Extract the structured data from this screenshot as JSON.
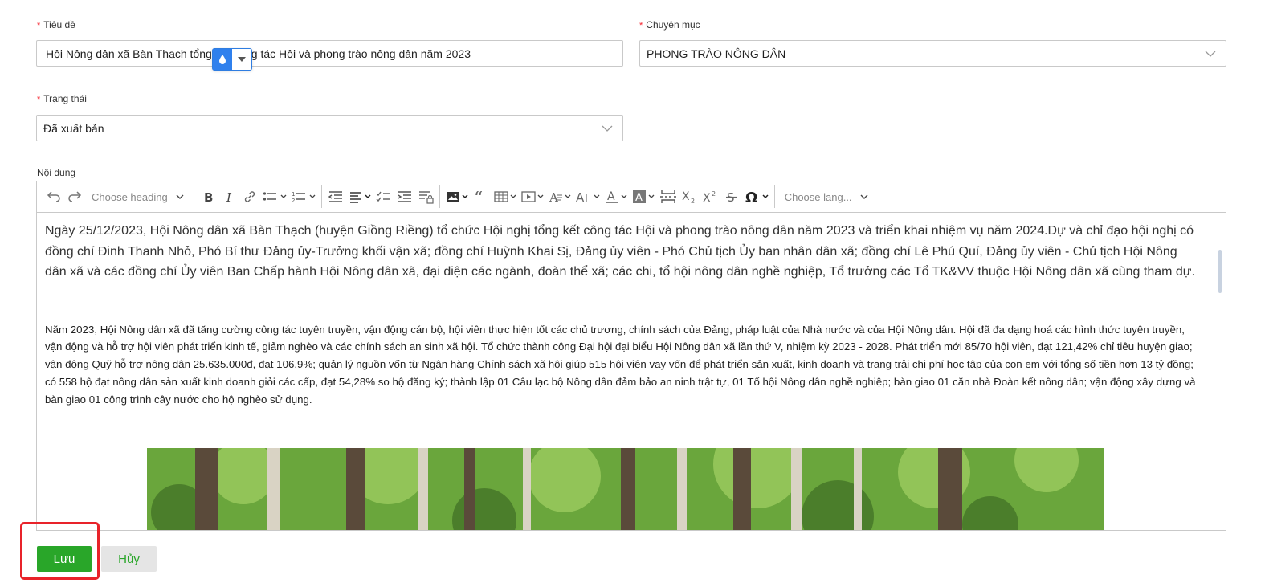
{
  "form": {
    "title_label": "Tiêu đề",
    "title_value": "Hội Nông dân xã Bàn Thạch tổng kết công tác Hội và phong trào nông dân năm 2023",
    "category_label": "Chuyên mục",
    "category_value": "PHONG TRÀO NÔNG DÂN",
    "status_label": "Trạng thái",
    "status_value": "Đã xuất bản",
    "content_label": "Nội dung",
    "required_mark": "*"
  },
  "toolbar": {
    "heading_placeholder": "Choose heading",
    "language_placeholder": "Choose lang..."
  },
  "content": {
    "lead_paragraph": "Ngày 25/12/2023, Hội Nông dân xã Bàn Thạch (huyện Giồng Riềng) tổ chức Hội nghị tổng kết công tác Hội và phong trào nông dân năm 2023 và triển khai nhiệm vụ năm 2024.Dự và chỉ đạo hội nghị có đồng chí Đinh Thanh Nhỏ, Phó Bí thư Đảng ủy-Trưởng khối vận xã; đồng chí Huỳnh Khai Sị, Đảng ủy viên - Phó Chủ tịch Ủy ban nhân dân xã; đồng chí Lê Phú Quí, Đảng ủy viên - Chủ tịch Hội Nông dân xã và các đồng chí Ủy viên Ban Chấp hành Hội Nông dân xã, đại diện các ngành, đoàn thể xã; các chi, tổ hội nông dân nghề nghiệp, Tổ trưởng các Tổ TK&VV thuộc Hội Nông dân xã cùng tham dự.",
    "body_paragraph": "Năm 2023, Hội Nông dân xã đã tăng cường công tác tuyên truyền, vận động cán bộ, hội viên thực hiện tốt các chủ trương, chính sách của Đảng, pháp luật của Nhà nước và của Hội Nông dân. Hội đã đa dạng hoá các hình thức tuyên truyền, vận động và hỗ trợ hội viên phát triển kinh tế, giảm nghèo và các chính sách an sinh xã hội. Tổ chức thành công Đại hội đại biểu Hội Nông dân xã lần thứ V, nhiệm kỳ 2023 - 2028. Phát triển mới 85/70 hội viên, đạt 121,42% chỉ tiêu huyện giao; vận động Quỹ hỗ trợ nông dân 25.635.000đ, đạt 106,9%; quản lý nguồn vốn từ Ngân hàng Chính sách xã hội giúp 515 hội viên vay vốn để phát triển sản xuất, kinh doanh và trang trải chi phí học tập của con em với tổng số tiền hơn 13 tỷ đồng; có 558 hộ đạt nông dân sản xuất kinh doanh giỏi các cấp, đạt 54,28% so hộ đăng ký; thành lập 01 Câu lạc bộ Nông dân đảm bảo an ninh trật tự, 01 Tổ hội Nông dân nghề nghiệp; bàn giao 01 căn nhà Đoàn kết nông dân; vận động xây dựng và bàn giao 01 công trình cây nước cho hộ nghèo sử dụng."
  },
  "actions": {
    "save_label": "Lưu",
    "cancel_label": "Hủy"
  },
  "colors": {
    "primary_green": "#29a629",
    "required_red": "#f5222d",
    "highlight_red": "#e8232a",
    "widget_blue": "#2f80ed"
  }
}
